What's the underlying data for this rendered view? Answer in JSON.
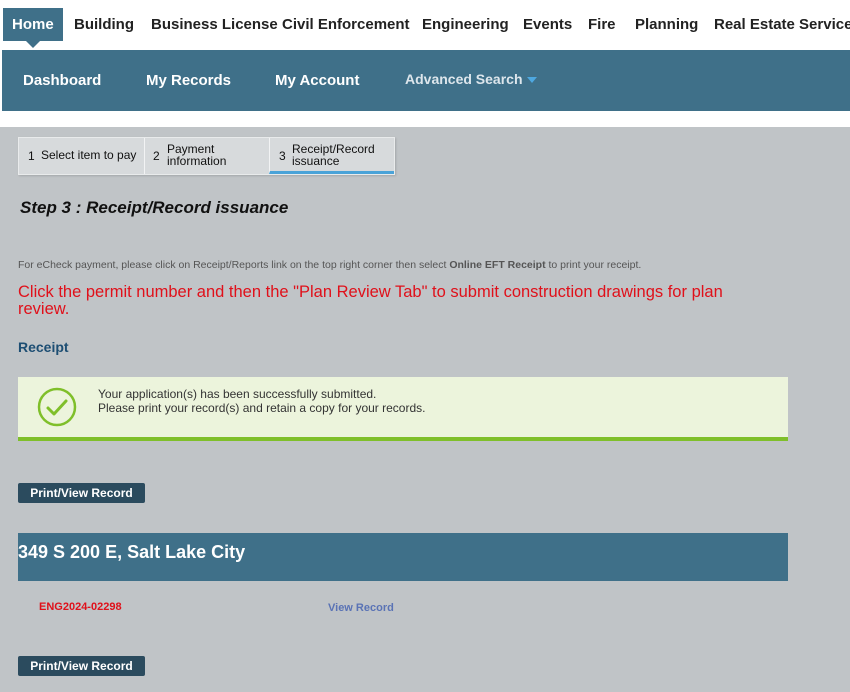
{
  "top_nav": {
    "tabs": [
      {
        "label": "Home",
        "active": true
      },
      {
        "label": "Building"
      },
      {
        "label": "Business License"
      },
      {
        "label": "Civil Enforcement"
      },
      {
        "label": "Engineering"
      },
      {
        "label": "Events"
      },
      {
        "label": "Fire"
      },
      {
        "label": "Planning"
      },
      {
        "label": "Real Estate Services"
      }
    ]
  },
  "sub_nav": {
    "items": [
      "Dashboard",
      "My Records",
      "My Account"
    ],
    "advanced_search": "Advanced Search"
  },
  "steps": [
    {
      "num": "1",
      "label": "Select item to pay"
    },
    {
      "num": "2",
      "label_line1": "Payment",
      "label_line2": "information"
    },
    {
      "num": "3",
      "label_line1": "Receipt/Record",
      "label_line2": "issuance",
      "current": true
    }
  ],
  "step_title": "Step 3 : Receipt/Record issuance",
  "note": {
    "pre": "For eCheck payment, please click on Receipt/Reports link on the top right corner then select ",
    "bold": "Online EFT Receipt",
    "post": " to print your receipt."
  },
  "red_message": "Click the permit number and then the \"Plan Review Tab\" to submit construction drawings for plan review.",
  "receipt_heading": "Receipt",
  "success": {
    "line1": "Your application(s) has been successfully submitted.",
    "line2": "Please print your record(s) and retain a copy for your records."
  },
  "print_button_label": "Print/View Record",
  "address": "349 S 200 E, Salt Lake City",
  "record": {
    "number": "ENG2024-02298",
    "link": "View Record"
  },
  "colors": {
    "brand": "#3f7089",
    "accent_blue": "#4aa3d8",
    "alert_red": "#e0101a",
    "success_green": "#7fbf2a"
  }
}
